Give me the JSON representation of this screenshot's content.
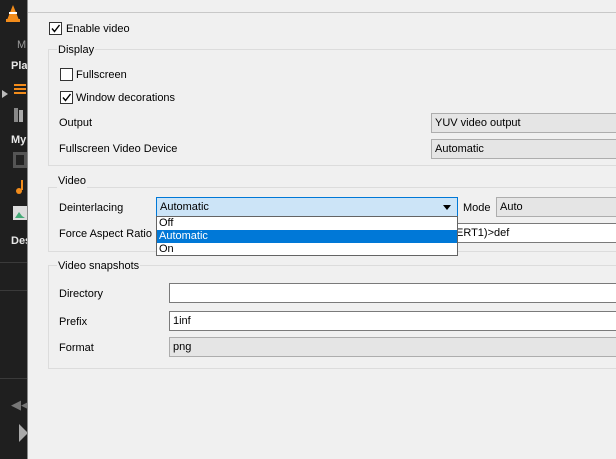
{
  "background_app": {
    "strip_texts": [
      "M",
      "Pla",
      "My",
      "Des"
    ]
  },
  "enable_video": {
    "label": "Enable video",
    "checked": true
  },
  "display": {
    "title": "Display",
    "fullscreen": {
      "label": "Fullscreen",
      "checked": false
    },
    "window_decorations": {
      "label": "Window decorations",
      "checked": true
    },
    "output": {
      "label": "Output",
      "value": "YUV video output"
    },
    "fullscreen_device": {
      "label": "Fullscreen Video Device",
      "value": "Automatic"
    }
  },
  "video": {
    "title": "Video",
    "deinterlacing": {
      "label": "Deinterlacing",
      "value": "Automatic",
      "options": [
        "Off",
        "Automatic",
        "On"
      ],
      "highlighted": "Automatic"
    },
    "mode": {
      "label": "Mode",
      "value": "Auto"
    },
    "force_aspect_ratio": {
      "label": "Force Aspect Ratio",
      "value_visible": "ERT1)>def"
    }
  },
  "snapshots": {
    "title": "Video snapshots",
    "directory": {
      "label": "Directory",
      "value": ""
    },
    "prefix": {
      "label": "Prefix",
      "value": "1inf"
    },
    "format": {
      "label": "Format",
      "value": "png"
    }
  },
  "colors": {
    "accent": "#0078d7",
    "dropdown_active": "#cce4f7",
    "vlc_orange": "#f28c1b"
  }
}
